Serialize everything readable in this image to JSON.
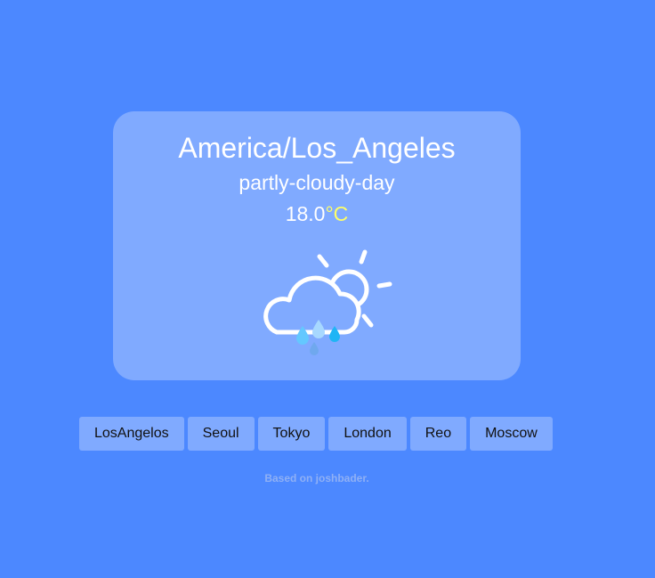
{
  "weather": {
    "timezone": "America/Los_Angeles",
    "summary": "partly-cloudy-day",
    "temperature": "18.0",
    "unit": "°C",
    "icon": "partly-cloudy-rain-icon"
  },
  "cities": [
    "LosAngelos",
    "Seoul",
    "Tokyo",
    "London",
    "Reo",
    "Moscow"
  ],
  "credit": "Based on joshbader.",
  "colors": {
    "background": "#4c88ff",
    "card": "#80aaff",
    "unit": "#ffff66",
    "credit": "#8fb0f5"
  }
}
